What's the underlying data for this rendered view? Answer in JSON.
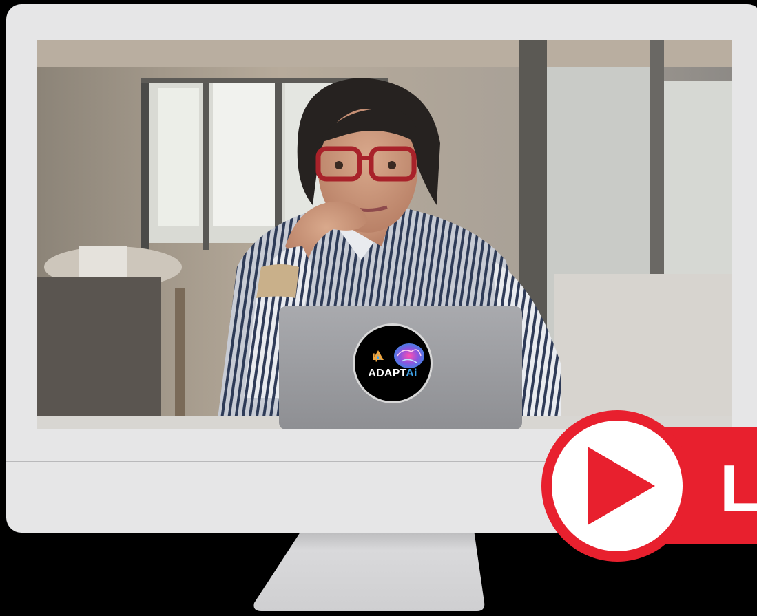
{
  "logo": {
    "brand_mark": "lp",
    "name_part1": "ADAPT",
    "name_part2": "Ai"
  },
  "badge": {
    "label": "L",
    "icon": "play-icon",
    "color": "#e8202e"
  },
  "colors": {
    "monitor": "#e6e6e7",
    "background": "#000000",
    "accent": "#e8202e"
  }
}
